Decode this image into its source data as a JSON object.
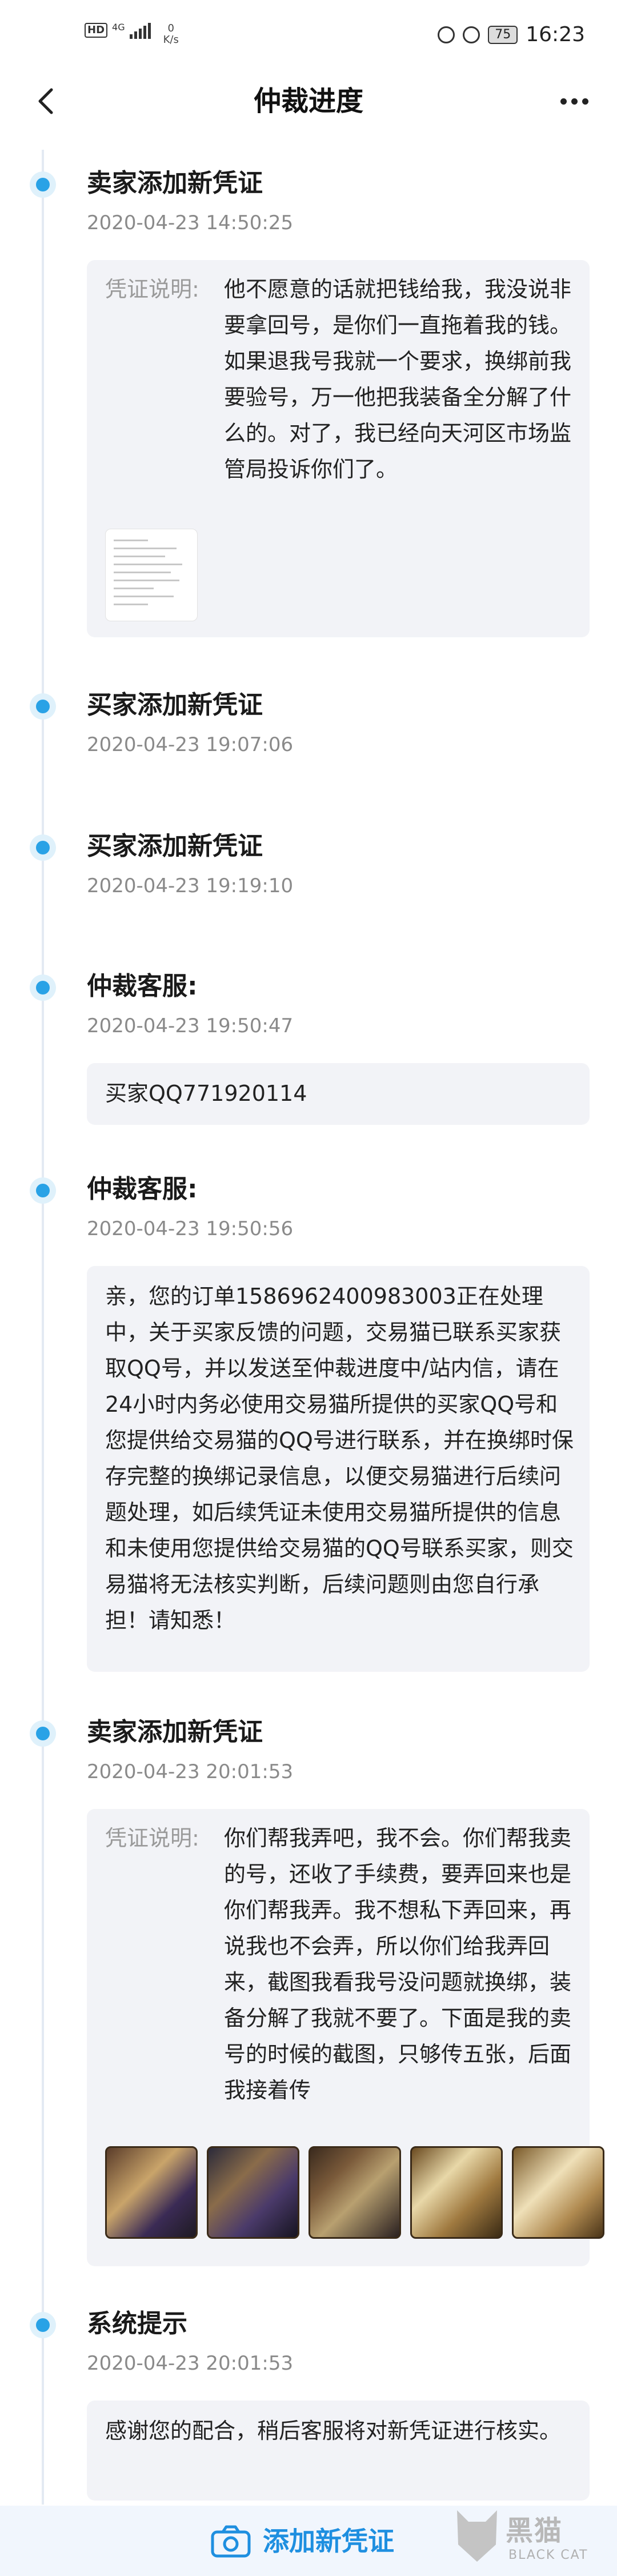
{
  "status_bar": {
    "hd": "HD",
    "network": "4G",
    "speed_value": "0",
    "speed_unit": "K/s",
    "battery": "75",
    "time": "16:23"
  },
  "header": {
    "title": "仲裁进度"
  },
  "entries": [
    {
      "title": "卖家添加新凭证",
      "time": "2020-04-23 14:50:25",
      "evidence_label": "凭证说明:",
      "evidence_text": "他不愿意的话就把钱给我，我没说非要拿回号，是你们一直拖着我的钱。如果退我号我就一个要求，换绑前我要验号，万一他把我装备全分解了什么的。对了，我已经向天河区市场监管局投诉你们了。"
    },
    {
      "title": "买家添加新凭证",
      "time": "2020-04-23 19:07:06"
    },
    {
      "title": "买家添加新凭证",
      "time": "2020-04-23 19:19:10"
    },
    {
      "title": "仲裁客服:",
      "time": "2020-04-23 19:50:47",
      "message": "买家QQ771920114"
    },
    {
      "title": "仲裁客服:",
      "time": "2020-04-23 19:50:56",
      "message": "亲，您的订单1586962400983003正在处理中，关于买家反馈的问题，交易猫已联系买家获取QQ号，并以发送至仲裁进度中/站内信，请在24小时内务必使用交易猫所提供的买家QQ号和您提供给交易猫的QQ号进行联系，并在换绑时保存完整的换绑记录信息，以便交易猫进行后续问题处理，如后续凭证未使用交易猫所提供的信息和未使用您提供给交易猫的QQ号联系买家，则交易猫将无法核实判断，后续问题则由您自行承担！请知悉！"
    },
    {
      "title": "卖家添加新凭证",
      "time": "2020-04-23 20:01:53",
      "evidence_label": "凭证说明:",
      "evidence_text": "你们帮我弄吧，我不会。你们帮我卖的号，还收了手续费，要弄回来也是你们帮我弄。我不想私下弄回来，再说我也不会弄，所以你们给我弄回来，截图我看我号没问题就换绑，装备分解了我就不要了。下面是我的卖号的时候的截图，只够传五张，后面我接着传"
    },
    {
      "title": "系统提示",
      "time": "2020-04-23 20:01:53",
      "message": "感谢您的配合，稍后客服将对新凭证进行核实。"
    }
  ],
  "bottom": {
    "add_button": "添加新凭证",
    "watermark": "黑猫",
    "watermark_sub": "BLACK CAT"
  },
  "colors": {
    "accent": "#1e8fe0",
    "timeline_dot": "#29a2e6",
    "card_bg": "#f2f3f7"
  }
}
